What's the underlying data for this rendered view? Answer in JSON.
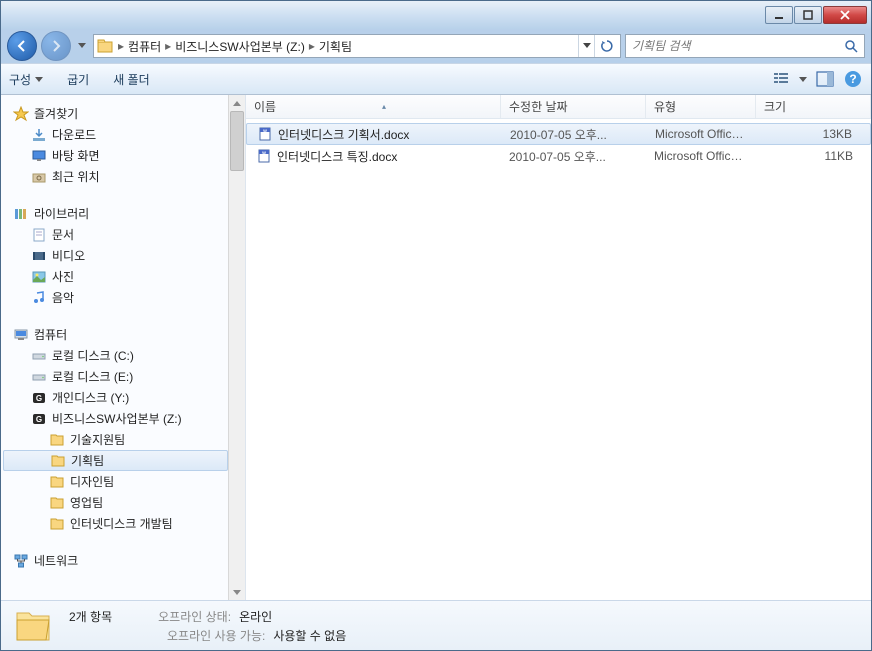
{
  "breadcrumbs": [
    "컴퓨터",
    "비즈니스SW사업본부 (Z:)",
    "기획팀"
  ],
  "search": {
    "placeholder": "기획팀 검색"
  },
  "toolbar": {
    "organize": "구성",
    "burn": "굽기",
    "new_folder": "새 폴더"
  },
  "columns": {
    "name": "이름",
    "date": "수정한 날짜",
    "type": "유형",
    "size": "크기"
  },
  "sidebar": {
    "favorites": {
      "label": "즐겨찾기",
      "items": [
        "다운로드",
        "바탕 화면",
        "최근 위치"
      ]
    },
    "libraries": {
      "label": "라이브러리",
      "items": [
        "문서",
        "비디오",
        "사진",
        "음악"
      ]
    },
    "computer": {
      "label": "컴퓨터",
      "drives": [
        "로컬 디스크 (C:)",
        "로컬 디스크 (E:)",
        "개인디스크 (Y:)"
      ],
      "network_drive": "비즈니스SW사업본부 (Z:)",
      "folders": [
        "기술지원팀",
        "기획팀",
        "디자인팀",
        "영업팀",
        "인터넷디스크 개발팀"
      ]
    },
    "network": {
      "label": "네트워크"
    }
  },
  "files": [
    {
      "name": "인터넷디스크 기획서.docx",
      "date": "2010-07-05 오후...",
      "type": "Microsoft Office ...",
      "size": "13KB",
      "selected": true
    },
    {
      "name": "인터넷디스크 특징.docx",
      "date": "2010-07-05 오후...",
      "type": "Microsoft Office ...",
      "size": "11KB",
      "selected": false
    }
  ],
  "status": {
    "count": "2개 항목",
    "offline_state_label": "오프라인 상태:",
    "offline_state_value": "온라인",
    "offline_avail_label": "오프라인 사용 가능:",
    "offline_avail_value": "사용할 수 없음"
  },
  "selected_folder": "기획팀"
}
